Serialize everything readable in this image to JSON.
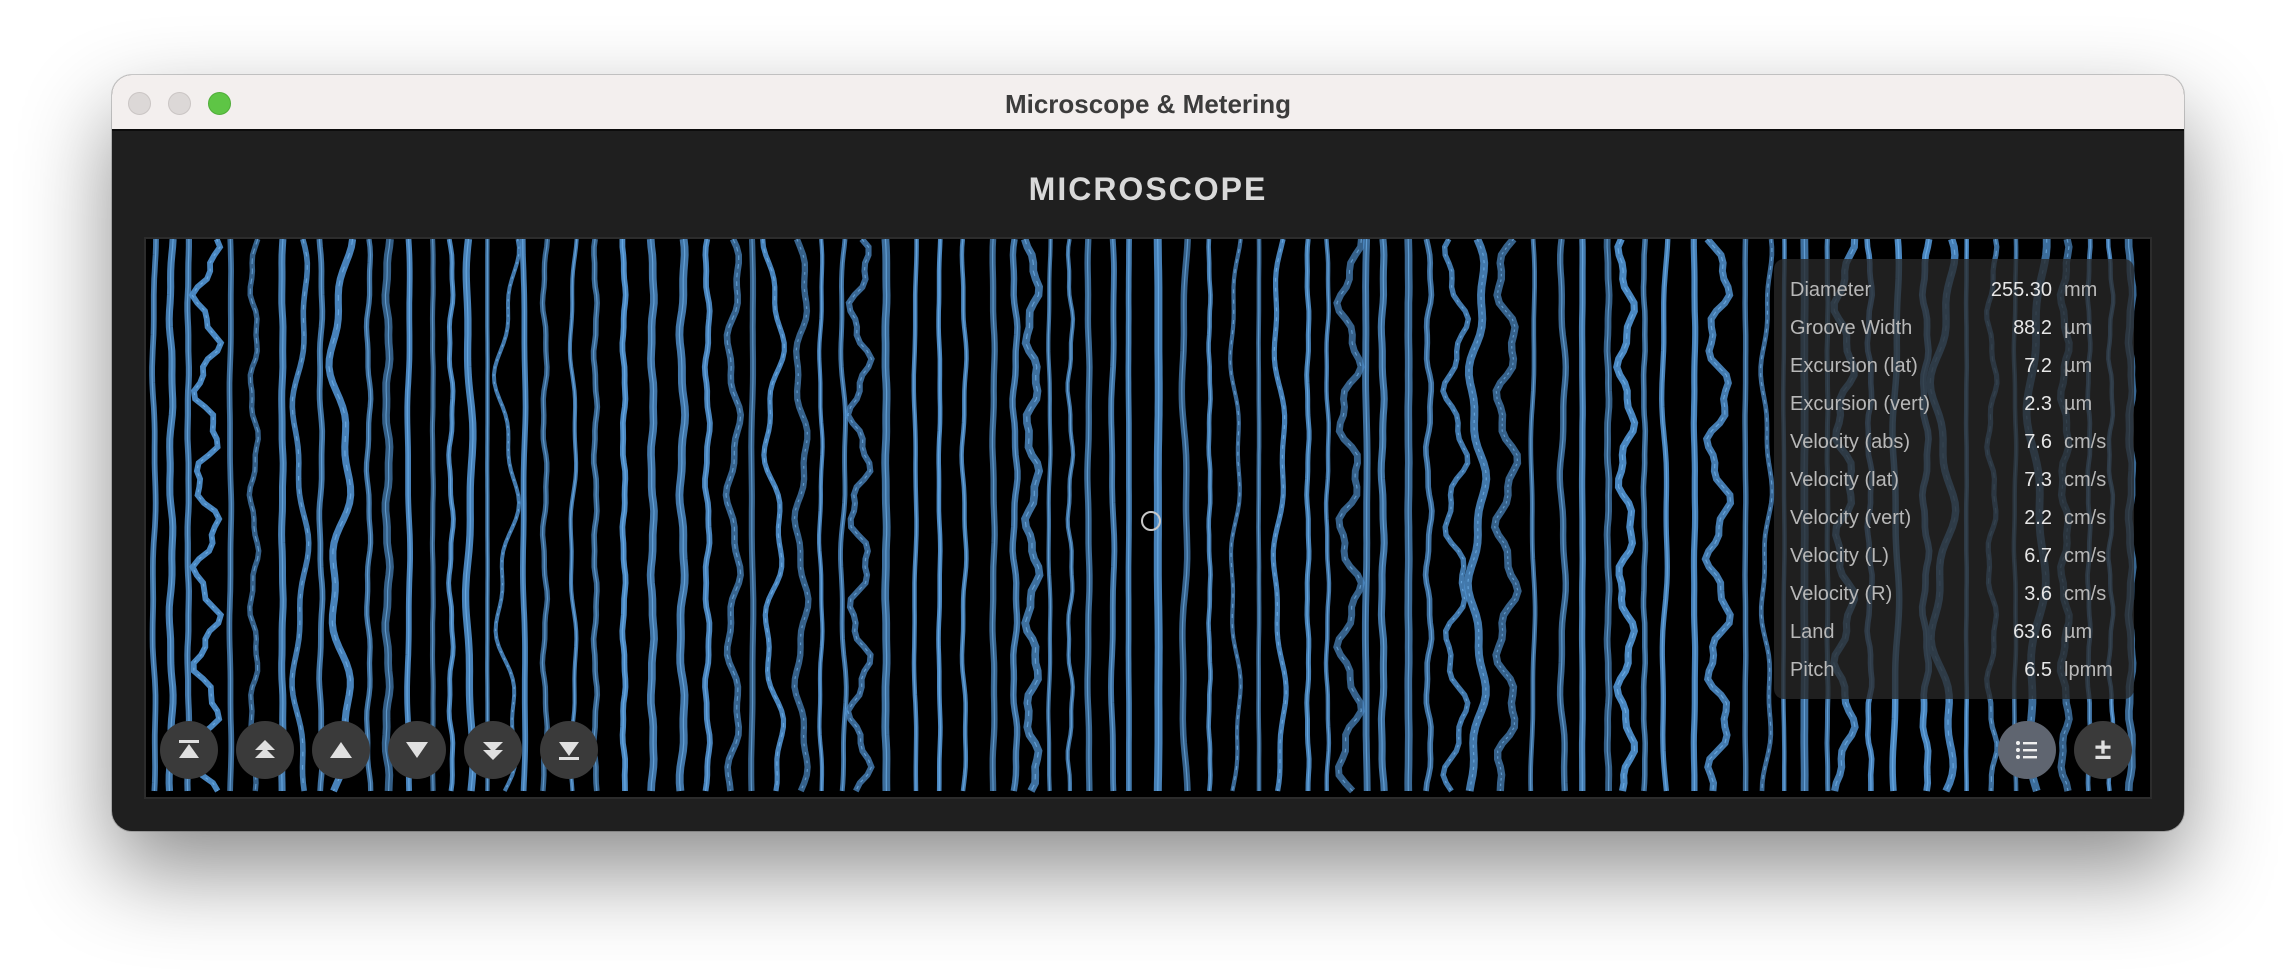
{
  "window": {
    "title": "Microscope & Metering"
  },
  "section_title": "MICROSCOPE",
  "colors": {
    "groove": "#4f8fcc",
    "groove_highlight": "#7fc4ff",
    "window_bg": "#1f1f1f",
    "zoom_button": "#5ec545"
  },
  "metrics": [
    {
      "label": "Diameter",
      "value": "255.30",
      "unit": "mm"
    },
    {
      "label": "Groove Width",
      "value": "88.2",
      "unit": "µm"
    },
    {
      "label": "Excursion (lat)",
      "value": "7.2",
      "unit": "µm"
    },
    {
      "label": "Excursion (vert)",
      "value": "2.3",
      "unit": "µm"
    },
    {
      "label": "Velocity (abs)",
      "value": "7.6",
      "unit": "cm/s"
    },
    {
      "label": "Velocity (lat)",
      "value": "7.3",
      "unit": "cm/s"
    },
    {
      "label": "Velocity (vert)",
      "value": "2.2",
      "unit": "cm/s"
    },
    {
      "label": "Velocity (L)",
      "value": "6.7",
      "unit": "cm/s"
    },
    {
      "label": "Velocity (R)",
      "value": "3.6",
      "unit": "cm/s"
    },
    {
      "label": "Land",
      "value": "63.6",
      "unit": "µm"
    },
    {
      "label": "Pitch",
      "value": "6.5",
      "unit": "lpmm"
    }
  ],
  "nav_buttons": [
    {
      "icon": "jump-to-top-icon"
    },
    {
      "icon": "page-up-icon"
    },
    {
      "icon": "step-up-icon"
    },
    {
      "icon": "step-down-icon"
    },
    {
      "icon": "page-down-icon"
    },
    {
      "icon": "jump-to-bottom-icon"
    }
  ],
  "right_buttons": {
    "list_icon": "list-icon",
    "plus_minus_label": "±"
  }
}
